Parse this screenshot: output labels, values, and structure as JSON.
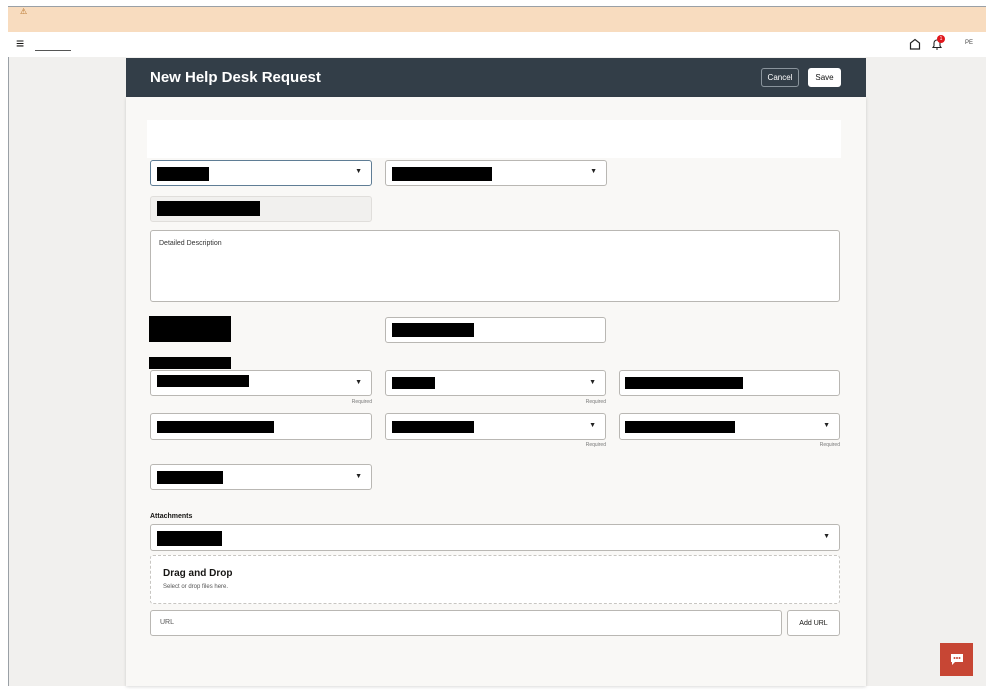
{
  "banner": {
    "icon": "warning-icon"
  },
  "topbar": {
    "menu_icon": "hamburger-icon",
    "home_icon": "home-icon",
    "notification_icon": "bell-icon",
    "notification_count": "1",
    "user_initials": "PE"
  },
  "form": {
    "title": "New Help Desk Request",
    "cancel_label": "Cancel",
    "save_label": "Save",
    "description_placeholder": "Detailed Description",
    "required_label": "Required",
    "attachments_label": "Attachments",
    "dropzone_title": "Drag and Drop",
    "dropzone_hint": "Select or drop files here.",
    "url_placeholder": "URL",
    "add_url_label": "Add URL"
  },
  "chat": {
    "icon": "chat-icon",
    "color": "#c74634"
  }
}
